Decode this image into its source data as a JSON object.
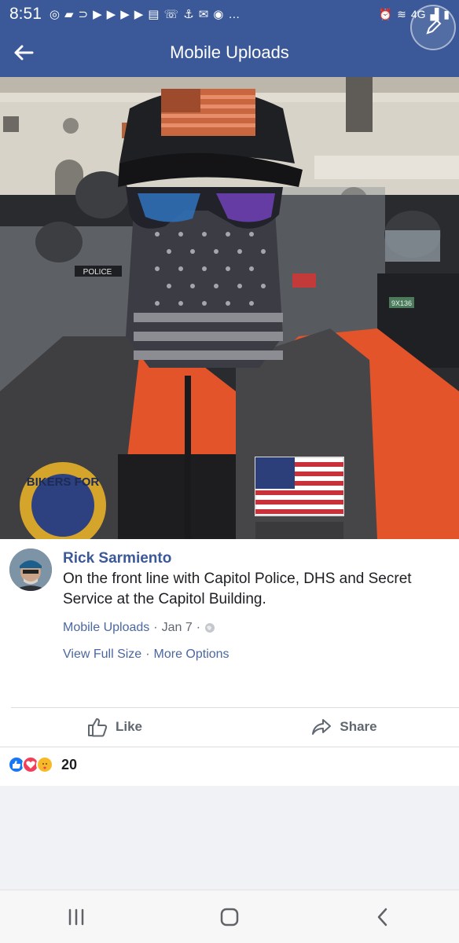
{
  "statusbar": {
    "time": "8:51",
    "network": "4G"
  },
  "appbar": {
    "title": "Mobile Uploads"
  },
  "post": {
    "author": "Rick Sarmiento",
    "caption": "On the front line with Capitol Police, DHS and Secret Service at the Capitol Building.",
    "album": "Mobile Uploads",
    "date": "Jan 7",
    "view_full_size": "View Full Size",
    "more_options": "More Options",
    "like_label": "Like",
    "share_label": "Share",
    "reaction_count": "20",
    "photo_text": {
      "police_text": "POLICE",
      "badge_text": "9X136",
      "patch_text": "BIKERS FOR"
    }
  },
  "colors": {
    "brand": "#3b5998",
    "link": "#4b67a1",
    "like": "#1877f2",
    "love": "#f33e58",
    "care": "#f7b928"
  }
}
